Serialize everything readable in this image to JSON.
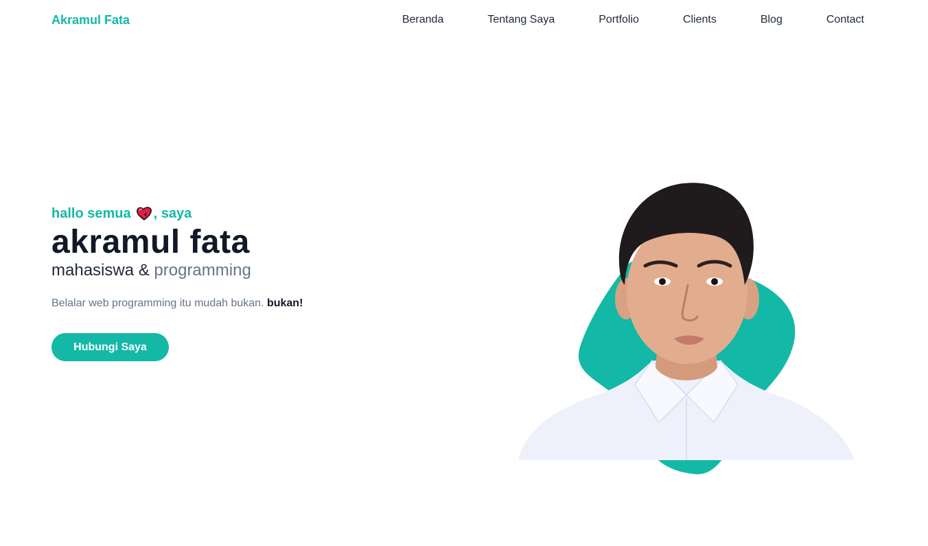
{
  "navbar": {
    "brand": "Akramul Fata",
    "links": [
      "Beranda",
      "Tentang Saya",
      "Portfolio",
      "Clients",
      "Blog",
      "Contact"
    ]
  },
  "hero": {
    "greeting_before": "hallo semua",
    "greeting_icon": "heart-icon",
    "greeting_after": ", saya",
    "name": "akramul fata",
    "role_prefix": "mahasiswa &",
    "role_accent": "programming",
    "description": "Belalar web programming itu mudah bukan.",
    "description_bold": "bukan!",
    "cta_label": "Hubungi Saya"
  },
  "colors": {
    "accent": "#14b8a6",
    "text_dark": "#111827",
    "text_muted": "#64748b"
  }
}
